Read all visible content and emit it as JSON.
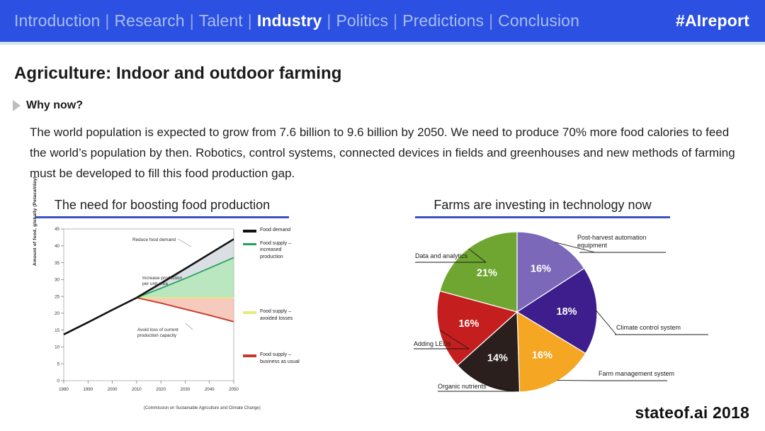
{
  "nav": {
    "items": [
      {
        "label": "Introduction",
        "active": false
      },
      {
        "label": "Research",
        "active": false
      },
      {
        "label": "Talent",
        "active": false
      },
      {
        "label": "Industry",
        "active": true
      },
      {
        "label": "Politics",
        "active": false
      },
      {
        "label": "Predictions",
        "active": false
      },
      {
        "label": "Conclusion",
        "active": false
      }
    ],
    "separator": "|",
    "hashtag": "#AIreport",
    "background_color": "#2B50E2",
    "inactive_color": "#A9BEEF",
    "active_color": "#FFFFFF"
  },
  "slide": {
    "title": "Agriculture: Indoor and outdoor farming",
    "section_label": "Why now?",
    "body": "The world population is expected to grow from 7.6 billion to 9.6 billion by 2050. We need to produce 70% more food calories to feed the world’s population by then. Robotics, control systems, connected devices in fields and greenhouses and new methods of farming must be developed to fill this food production gap."
  },
  "panels": {
    "left_header": "The need for boosting food production",
    "right_header": "Farms are investing in technology now",
    "header_rule_color": "#3B54C4"
  },
  "footer": {
    "brand": "stateof.ai 2018"
  },
  "chart_data": [
    {
      "type": "line",
      "title": "The need for boosting food production",
      "xlabel": "",
      "ylabel": "Amount of food, globally (Petacal/day)",
      "xlim": [
        1980,
        2050
      ],
      "ylim": [
        0,
        45
      ],
      "xticks": [
        1980,
        1990,
        2000,
        2010,
        2020,
        2030,
        2040,
        2050
      ],
      "yticks": [
        0,
        5,
        10,
        15,
        20,
        25,
        30,
        35,
        40,
        45
      ],
      "grid": false,
      "legend_position": "right",
      "caption": "(Commission on Sustainable Agriculture and Climate Change)",
      "x": [
        1980,
        1990,
        2000,
        2010,
        2020,
        2030,
        2040,
        2050
      ],
      "series": [
        {
          "name": "Food demand",
          "color": "#111111",
          "values": [
            13.7,
            17.3,
            21.0,
            24.6,
            28.9,
            33.2,
            37.6,
            42.0
          ]
        },
        {
          "name": "Food supply – increased production",
          "color": "#1FA05A",
          "values": [
            13.7,
            17.3,
            21.0,
            24.6,
            27.4,
            30.3,
            33.4,
            36.5
          ]
        },
        {
          "name": "Food supply – avoided losses",
          "color": "#E8EA7E",
          "values": [
            13.7,
            17.3,
            21.0,
            24.6,
            24.6,
            24.6,
            24.6,
            24.6
          ]
        },
        {
          "name": "Food supply – business as usual",
          "color": "#C63A2E",
          "values": [
            13.7,
            17.3,
            21.0,
            24.6,
            23.0,
            21.2,
            19.4,
            17.5
          ]
        }
      ],
      "annotations": [
        {
          "text": "Reduce food demand",
          "near": "top"
        },
        {
          "text": "Increase production\nper unit area",
          "near": "middle"
        },
        {
          "text": "Avoid loss of current\nproduction capacity",
          "near": "bottom"
        }
      ]
    },
    {
      "type": "pie",
      "title": "Farms are investing in technology now",
      "legend_position": "callout-labels",
      "labels": [
        "Post-harvest automation equipment",
        "Climate control system",
        "Farm management system",
        "Organic nutrients",
        "Adding LEDs",
        "Data and analytics"
      ],
      "values": [
        16,
        18,
        16,
        14,
        16,
        21
      ],
      "value_labels": [
        "16%",
        "18%",
        "16%",
        "14%",
        "16%",
        "21%"
      ],
      "colors": [
        "#7B68B8",
        "#3D1E8C",
        "#F5A623",
        "#2A1F1C",
        "#C41E1E",
        "#6FA631"
      ]
    }
  ]
}
